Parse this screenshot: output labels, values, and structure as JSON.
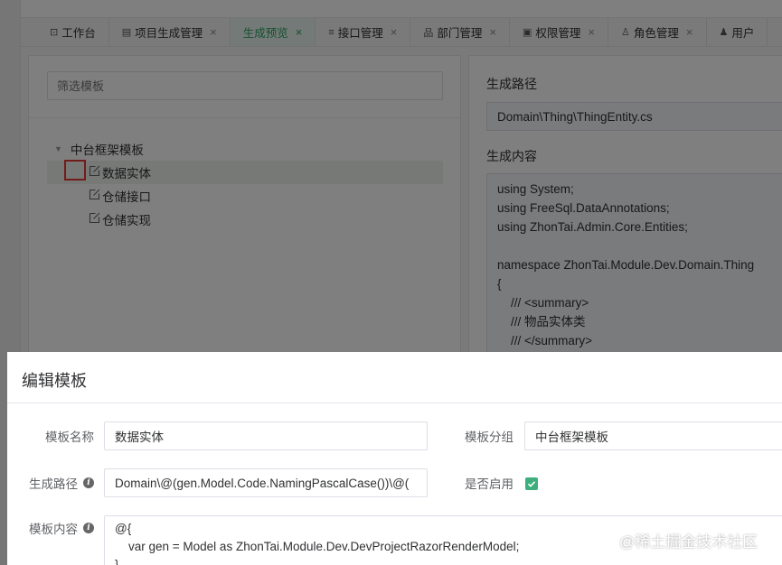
{
  "tabs": [
    {
      "icon": "dashboard-icon",
      "label": "工作台",
      "closable": false,
      "active": false
    },
    {
      "icon": "list-icon",
      "label": "项目生成管理",
      "closable": true,
      "active": false
    },
    {
      "icon": "",
      "label": "生成预览",
      "closable": true,
      "active": true
    },
    {
      "icon": "menu-icon",
      "label": "接口管理",
      "closable": true,
      "active": false
    },
    {
      "icon": "org-icon",
      "label": "部门管理",
      "closable": true,
      "active": false
    },
    {
      "icon": "permission-icon",
      "label": "权限管理",
      "closable": true,
      "active": false
    },
    {
      "icon": "user-icon",
      "label": "角色管理",
      "closable": true,
      "active": false
    },
    {
      "icon": "user-solid-icon",
      "label": "用户",
      "closable": false,
      "active": false
    }
  ],
  "tab_glyphs": {
    "close": "×",
    "dashboard": "⊡",
    "list": "▤",
    "menu": "≡",
    "org": "品",
    "permission": "▣",
    "user": "♙",
    "user_solid": "♟"
  },
  "left_panel": {
    "filter_placeholder": "筛选模板",
    "tree": {
      "root_label": "中台框架模板",
      "children": [
        "数据实体",
        "仓储接口",
        "仓储实现"
      ],
      "selected_index": 0
    }
  },
  "right_panel": {
    "path_label": "生成路径",
    "path_value": "Domain\\Thing\\ThingEntity.cs",
    "content_label": "生成内容",
    "code_lines": [
      "using System;",
      "using FreeSql.DataAnnotations;",
      "using ZhonTai.Admin.Core.Entities;",
      "",
      "namespace ZhonTai.Module.Dev.Domain.Thing",
      "{",
      "    /// <summary>",
      "    /// 物品实体类",
      "    /// </summary>"
    ]
  },
  "dialog": {
    "title": "编辑模板",
    "name_label": "模板名称",
    "name_value": "数据实体",
    "group_label": "模板分组",
    "group_value": "中台框架模板",
    "path_label": "生成路径",
    "path_value": "Domain\\@(gen.Model.Code.NamingPascalCase())\\@(",
    "enabled_label": "是否启用",
    "enabled": true,
    "content_label": "模板内容",
    "content_lines": [
      "@{",
      "    var gen = Model as ZhonTai.Module.Dev.DevProjectRazorRenderModel;",
      "}"
    ]
  },
  "watermark": "@稀土掘金技术社区",
  "colors": {
    "accent": "#2aa060",
    "checkbox": "#3eaf7c",
    "highlight": "#e53935"
  }
}
